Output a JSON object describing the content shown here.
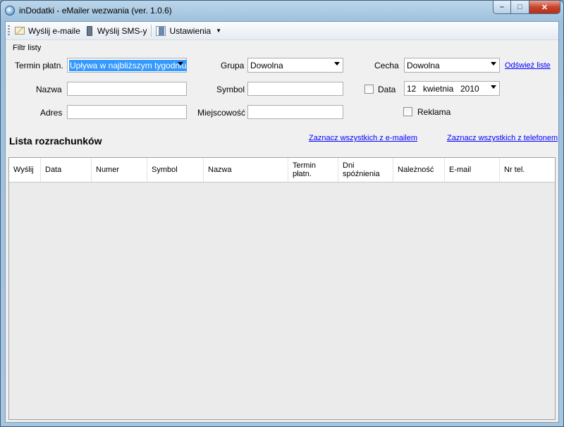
{
  "window": {
    "title": "inDodatki - eMailer wezwania (ver. 1.0.6)"
  },
  "toolbar": {
    "send_emails": "Wyślij e-maile",
    "send_sms": "Wyślij SMS-y",
    "settings": "Ustawienia"
  },
  "filter": {
    "group_title": "Filtr listy",
    "termin_label": "Termin płatn.",
    "termin_value": "Upływa w najbliższym tygodniu",
    "grupa_label": "Grupa",
    "grupa_value": "Dowolna",
    "cecha_label": "Cecha",
    "cecha_value": "Dowolna",
    "refresh_link": "Odśwież liste",
    "nazwa_label": "Nazwa",
    "nazwa_value": "",
    "symbol_label": "Symbol",
    "symbol_value": "",
    "data_label": "Data",
    "data_checked": false,
    "date_day": "12",
    "date_month": "kwietnia",
    "date_year": "2010",
    "adres_label": "Adres",
    "adres_value": "",
    "miejscowosc_label": "Miejscowość",
    "miejscowosc_value": "",
    "reklama_label": "Reklama",
    "reklama_checked": false
  },
  "list": {
    "title": "Lista rozrachunków",
    "select_all_email": "Zaznacz wszystkich z e-mailem",
    "select_all_phone": "Zaznacz wszystkich z telefonem",
    "columns": {
      "send": "Wyślij",
      "date": "Data",
      "number": "Numer",
      "symbol": "Symbol",
      "name": "Nazwa",
      "due_line1": "Termin",
      "due_line2": "płatn.",
      "late_line1": "Dni",
      "late_line2": "spóźnienia",
      "amount": "Należność",
      "email": "E-mail",
      "phone": "Nr tel."
    },
    "rows": []
  },
  "icons": [
    "app-icon",
    "mail-icon",
    "phone-icon",
    "settings-icon",
    "chevron-down-icon"
  ],
  "colors": {
    "link": "#0000ff",
    "selection": "#3399ff",
    "close_button": "#c9442c"
  }
}
